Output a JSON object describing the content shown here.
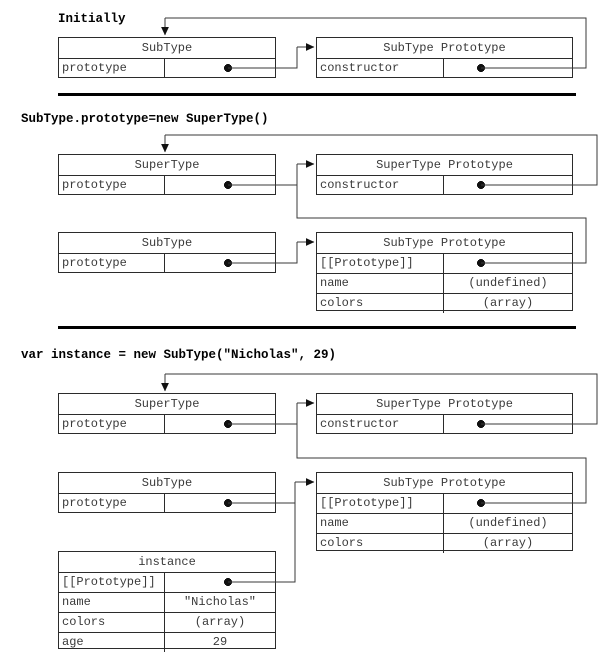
{
  "diagram": {
    "title_font": "monospace",
    "sections": [
      {
        "heading": "Initially",
        "boxes": [
          {
            "name": "subtype-constructor",
            "title": "SubType",
            "rows": [
              {
                "key": "prototype",
                "value": "",
                "pointer": true
              }
            ]
          },
          {
            "name": "subtype-prototype",
            "title": "SubType Prototype",
            "rows": [
              {
                "key": "constructor",
                "value": "",
                "pointer": true
              }
            ]
          }
        ]
      },
      {
        "heading": "SubType.prototype=new SuperType()",
        "boxes": [
          {
            "name": "supertype-constructor",
            "title": "SuperType",
            "rows": [
              {
                "key": "prototype",
                "value": "",
                "pointer": true
              }
            ]
          },
          {
            "name": "supertype-prototype",
            "title": "SuperType Prototype",
            "rows": [
              {
                "key": "constructor",
                "value": "",
                "pointer": true
              }
            ]
          },
          {
            "name": "subtype-constructor",
            "title": "SubType",
            "rows": [
              {
                "key": "prototype",
                "value": "",
                "pointer": true
              }
            ]
          },
          {
            "name": "subtype-prototype",
            "title": "SubType Prototype",
            "rows": [
              {
                "key": "[[Prototype]]",
                "value": "",
                "pointer": true
              },
              {
                "key": "name",
                "value": "(undefined)",
                "pointer": false
              },
              {
                "key": "colors",
                "value": "(array)",
                "pointer": false
              }
            ]
          }
        ]
      },
      {
        "heading": "var instance = new SubType(\"Nicholas\", 29)",
        "boxes": [
          {
            "name": "supertype-constructor",
            "title": "SuperType",
            "rows": [
              {
                "key": "prototype",
                "value": "",
                "pointer": true
              }
            ]
          },
          {
            "name": "supertype-prototype",
            "title": "SuperType Prototype",
            "rows": [
              {
                "key": "constructor",
                "value": "",
                "pointer": true
              }
            ]
          },
          {
            "name": "subtype-constructor",
            "title": "SubType",
            "rows": [
              {
                "key": "prototype",
                "value": "",
                "pointer": true
              }
            ]
          },
          {
            "name": "subtype-prototype",
            "title": "SubType Prototype",
            "rows": [
              {
                "key": "[[Prototype]]",
                "value": "",
                "pointer": true
              },
              {
                "key": "name",
                "value": "(undefined)",
                "pointer": false
              },
              {
                "key": "colors",
                "value": "(array)",
                "pointer": false
              }
            ]
          },
          {
            "name": "instance-object",
            "title": "instance",
            "rows": [
              {
                "key": "[[Prototype]]",
                "value": "",
                "pointer": true
              },
              {
                "key": "name",
                "value": "\"Nicholas\"",
                "pointer": false
              },
              {
                "key": "colors",
                "value": "(array)",
                "pointer": false
              },
              {
                "key": "age",
                "value": "29",
                "pointer": false
              }
            ]
          }
        ]
      }
    ],
    "colors": {
      "stroke": "#2b2b2b",
      "wire": "#3a3a3a",
      "text": "#3a3a3a",
      "heading": "#000000",
      "divider": "#000000",
      "background": "#ffffff"
    }
  }
}
